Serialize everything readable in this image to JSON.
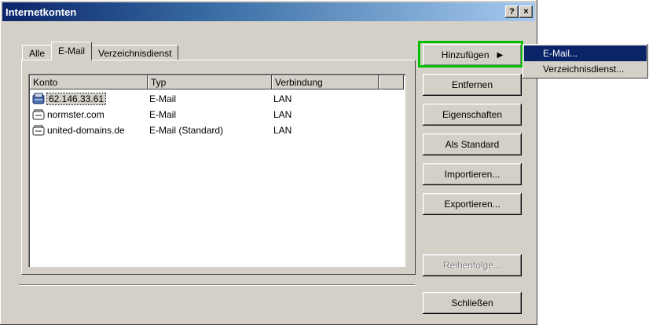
{
  "window": {
    "title": "Internetkonten",
    "help_button": "?",
    "close_button": "×"
  },
  "tabs": [
    {
      "label": "Alle"
    },
    {
      "label": "E-Mail"
    },
    {
      "label": "Verzeichnisdienst"
    }
  ],
  "active_tab": "E-Mail",
  "list": {
    "columns": [
      "Konto",
      "Typ",
      "Verbindung"
    ],
    "rows": [
      {
        "konto": "62.146.33.61",
        "typ": "E-Mail",
        "verbindung": "LAN",
        "selected": true
      },
      {
        "konto": "normster.com",
        "typ": "E-Mail",
        "verbindung": "LAN",
        "selected": false
      },
      {
        "konto": "united-domains.de",
        "typ": "E-Mail (Standard)",
        "verbindung": "LAN",
        "selected": false
      }
    ]
  },
  "buttons": {
    "add": "Hinzufügen",
    "remove": "Entfernen",
    "properties": "Eigenschaften",
    "set_default": "Als Standard",
    "import": "Importieren...",
    "export": "Exportieren...",
    "order": "Reihenfolge...",
    "close": "Schließen"
  },
  "submenu": {
    "items": [
      "E-Mail...",
      "Verzeichnisdienst..."
    ],
    "highlighted_index": 0
  },
  "colors": {
    "titlebar_start": "#0a246a",
    "highlight_box": "#00c000",
    "menu_selection": "#0a246a"
  }
}
